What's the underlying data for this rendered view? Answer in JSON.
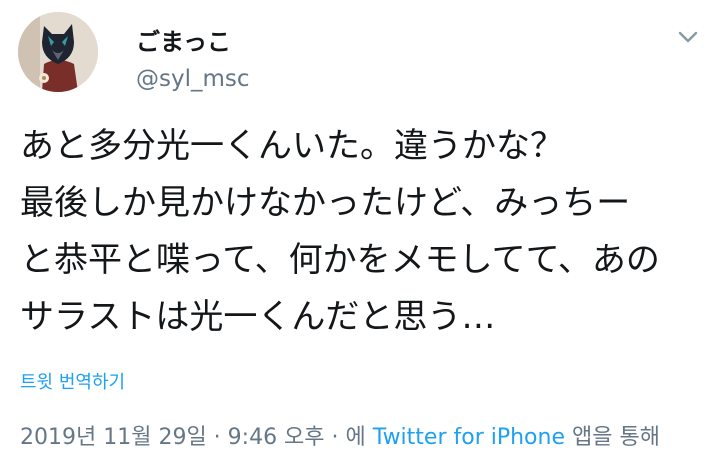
{
  "tweet": {
    "display_name": "ごまっこ",
    "handle": "@syl_msc",
    "text_lines": [
      "あと多分光一くんいた。違うかな？",
      "最後しか見かけなかったけど、みっちー",
      "と恭平と喋って、何かをメモしてて、あの",
      "サラストは光一くんだと思う…"
    ],
    "translate_label": "트윗 번역하기",
    "timestamp": "2019년 11월 29일 · 9:46 오후 · 에",
    "source": "Twitter for iPhone",
    "source_suffix": "앱을 통해"
  },
  "icons": {
    "menu": "chevron-down-icon",
    "avatar": "avatar"
  },
  "colors": {
    "accent": "#1da1f2",
    "text": "#14171a",
    "muted": "#657786"
  }
}
